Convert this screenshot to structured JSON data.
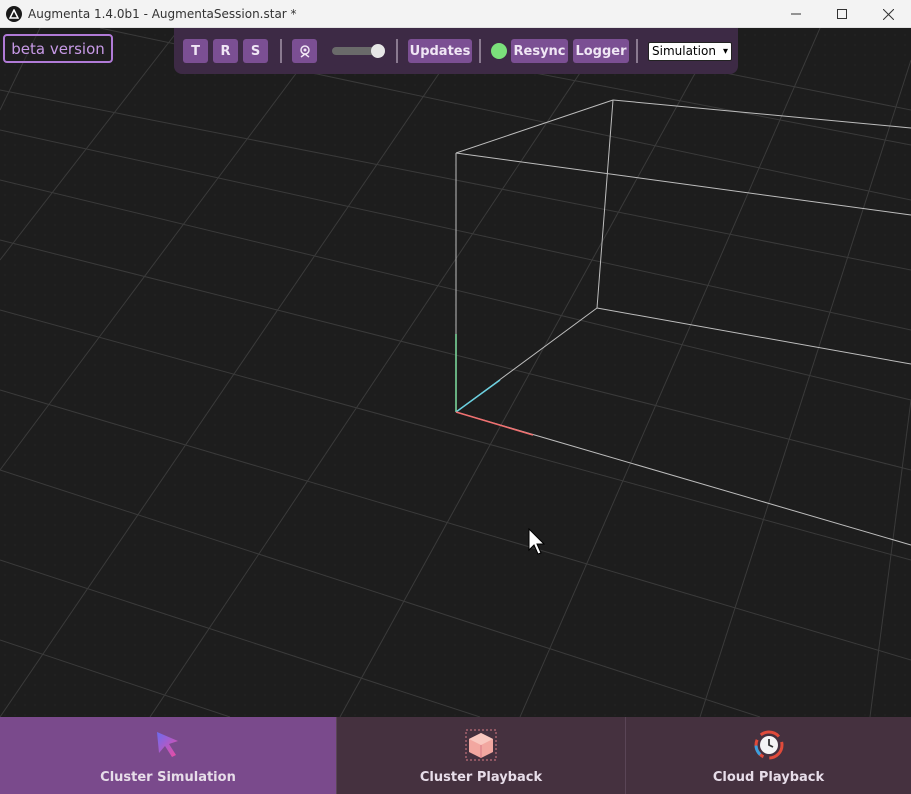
{
  "window": {
    "title": "Augmenta 1.4.0b1 - AugmentaSession.star *",
    "controls": {
      "minimize": "minimize-icon",
      "maximize": "maximize-icon",
      "close": "close-icon"
    }
  },
  "badge": {
    "label": "beta version"
  },
  "toolbar": {
    "translate_label": "T",
    "rotate_label": "R",
    "scale_label": "S",
    "camera_icon": "camera-icon",
    "updates_label": "Updates",
    "status_color": "#7be07b",
    "resync_label": "Resync",
    "logger_label": "Logger",
    "mode_select": {
      "selected": "Simulation"
    }
  },
  "tabs": [
    {
      "label": "Cluster Simulation",
      "icon": "cursor-icon",
      "active": true
    },
    {
      "label": "Cluster Playback",
      "icon": "cube-icon",
      "active": false
    },
    {
      "label": "Cloud Playback",
      "icon": "clock-icon",
      "active": false
    }
  ],
  "colors": {
    "accent": "#7a4a8c",
    "toolbar_bg": "#3d2a45",
    "beta_border": "#b07ad6"
  }
}
